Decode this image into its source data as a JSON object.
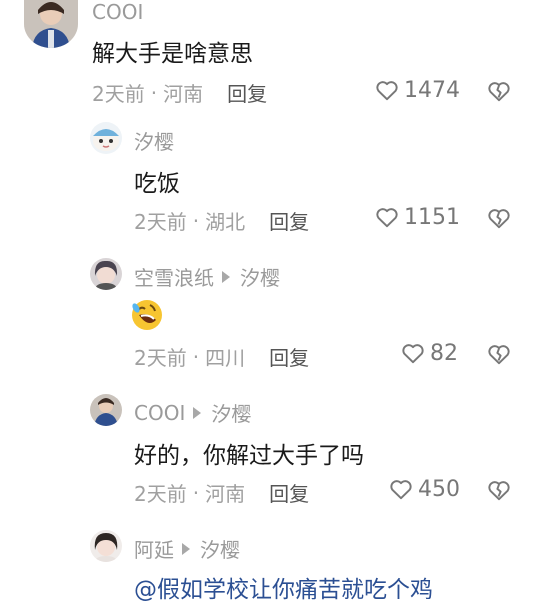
{
  "comments": [
    {
      "username": "COOI",
      "reply_to": "",
      "text": "解大手是啥意思",
      "time": "2天前",
      "location": "河南",
      "reply_label": "回复",
      "likes": "1474"
    },
    {
      "username": "汐樱",
      "reply_to": "",
      "text": "吃饭",
      "time": "2天前",
      "location": "湖北",
      "reply_label": "回复",
      "likes": "1151"
    },
    {
      "username": "空雪浪纸",
      "reply_to": "汐樱",
      "text": "",
      "emoji": "rolling-laughing-emoji",
      "time": "2天前",
      "location": "四川",
      "reply_label": "回复",
      "likes": "82"
    },
    {
      "username": "COOI",
      "reply_to": "汐樱",
      "text": "好的，你解过大手了吗",
      "time": "2天前",
      "location": "河南",
      "reply_label": "回复",
      "likes": "450"
    },
    {
      "username": "阿延",
      "reply_to": "汐樱",
      "text": "@假如学校让你痛苦就吃个鸡"
    }
  ],
  "separator": "·",
  "icons": {
    "like": "heart-outline-icon",
    "dislike": "broken-heart-icon"
  },
  "colors": {
    "mention": "#2b4f93",
    "meta": "#a0a0a0",
    "username": "#9a9a9a"
  }
}
